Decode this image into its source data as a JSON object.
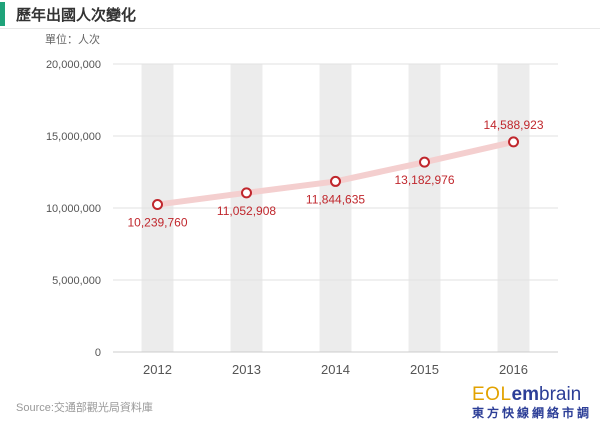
{
  "title": "歷年出國人次變化",
  "unit_label": "單位：人次",
  "source": "Source:交通部觀光局資料庫",
  "logo": {
    "part1": "EOL",
    "part2": "em",
    "part3": "brain",
    "sub": "東方快線網絡市調"
  },
  "colors": {
    "accent": "#1fa37a",
    "line": "#f4cfcf",
    "marker": "#c0272d",
    "label": "#c0272d",
    "band": "#ececec"
  },
  "chart_data": {
    "type": "line",
    "title": "歷年出國人次變化",
    "xlabel": "",
    "ylabel": "單位：人次",
    "categories": [
      "2012",
      "2013",
      "2014",
      "2015",
      "2016"
    ],
    "series": [
      {
        "values": [
          10239760,
          11052908,
          11844635,
          13182976,
          14588923
        ]
      }
    ],
    "data_labels": [
      "10,239,760",
      "11,052,908",
      "11,844,635",
      "13,182,976",
      "14,588,923"
    ],
    "y_ticks": [
      0,
      5000000,
      10000000,
      15000000,
      20000000
    ],
    "y_tick_labels": [
      "0",
      "5,000,000",
      "10,000,000",
      "15,000,000",
      "20,000,000"
    ],
    "ylim": [
      0,
      20000000
    ],
    "grid": true,
    "legend": "none"
  }
}
